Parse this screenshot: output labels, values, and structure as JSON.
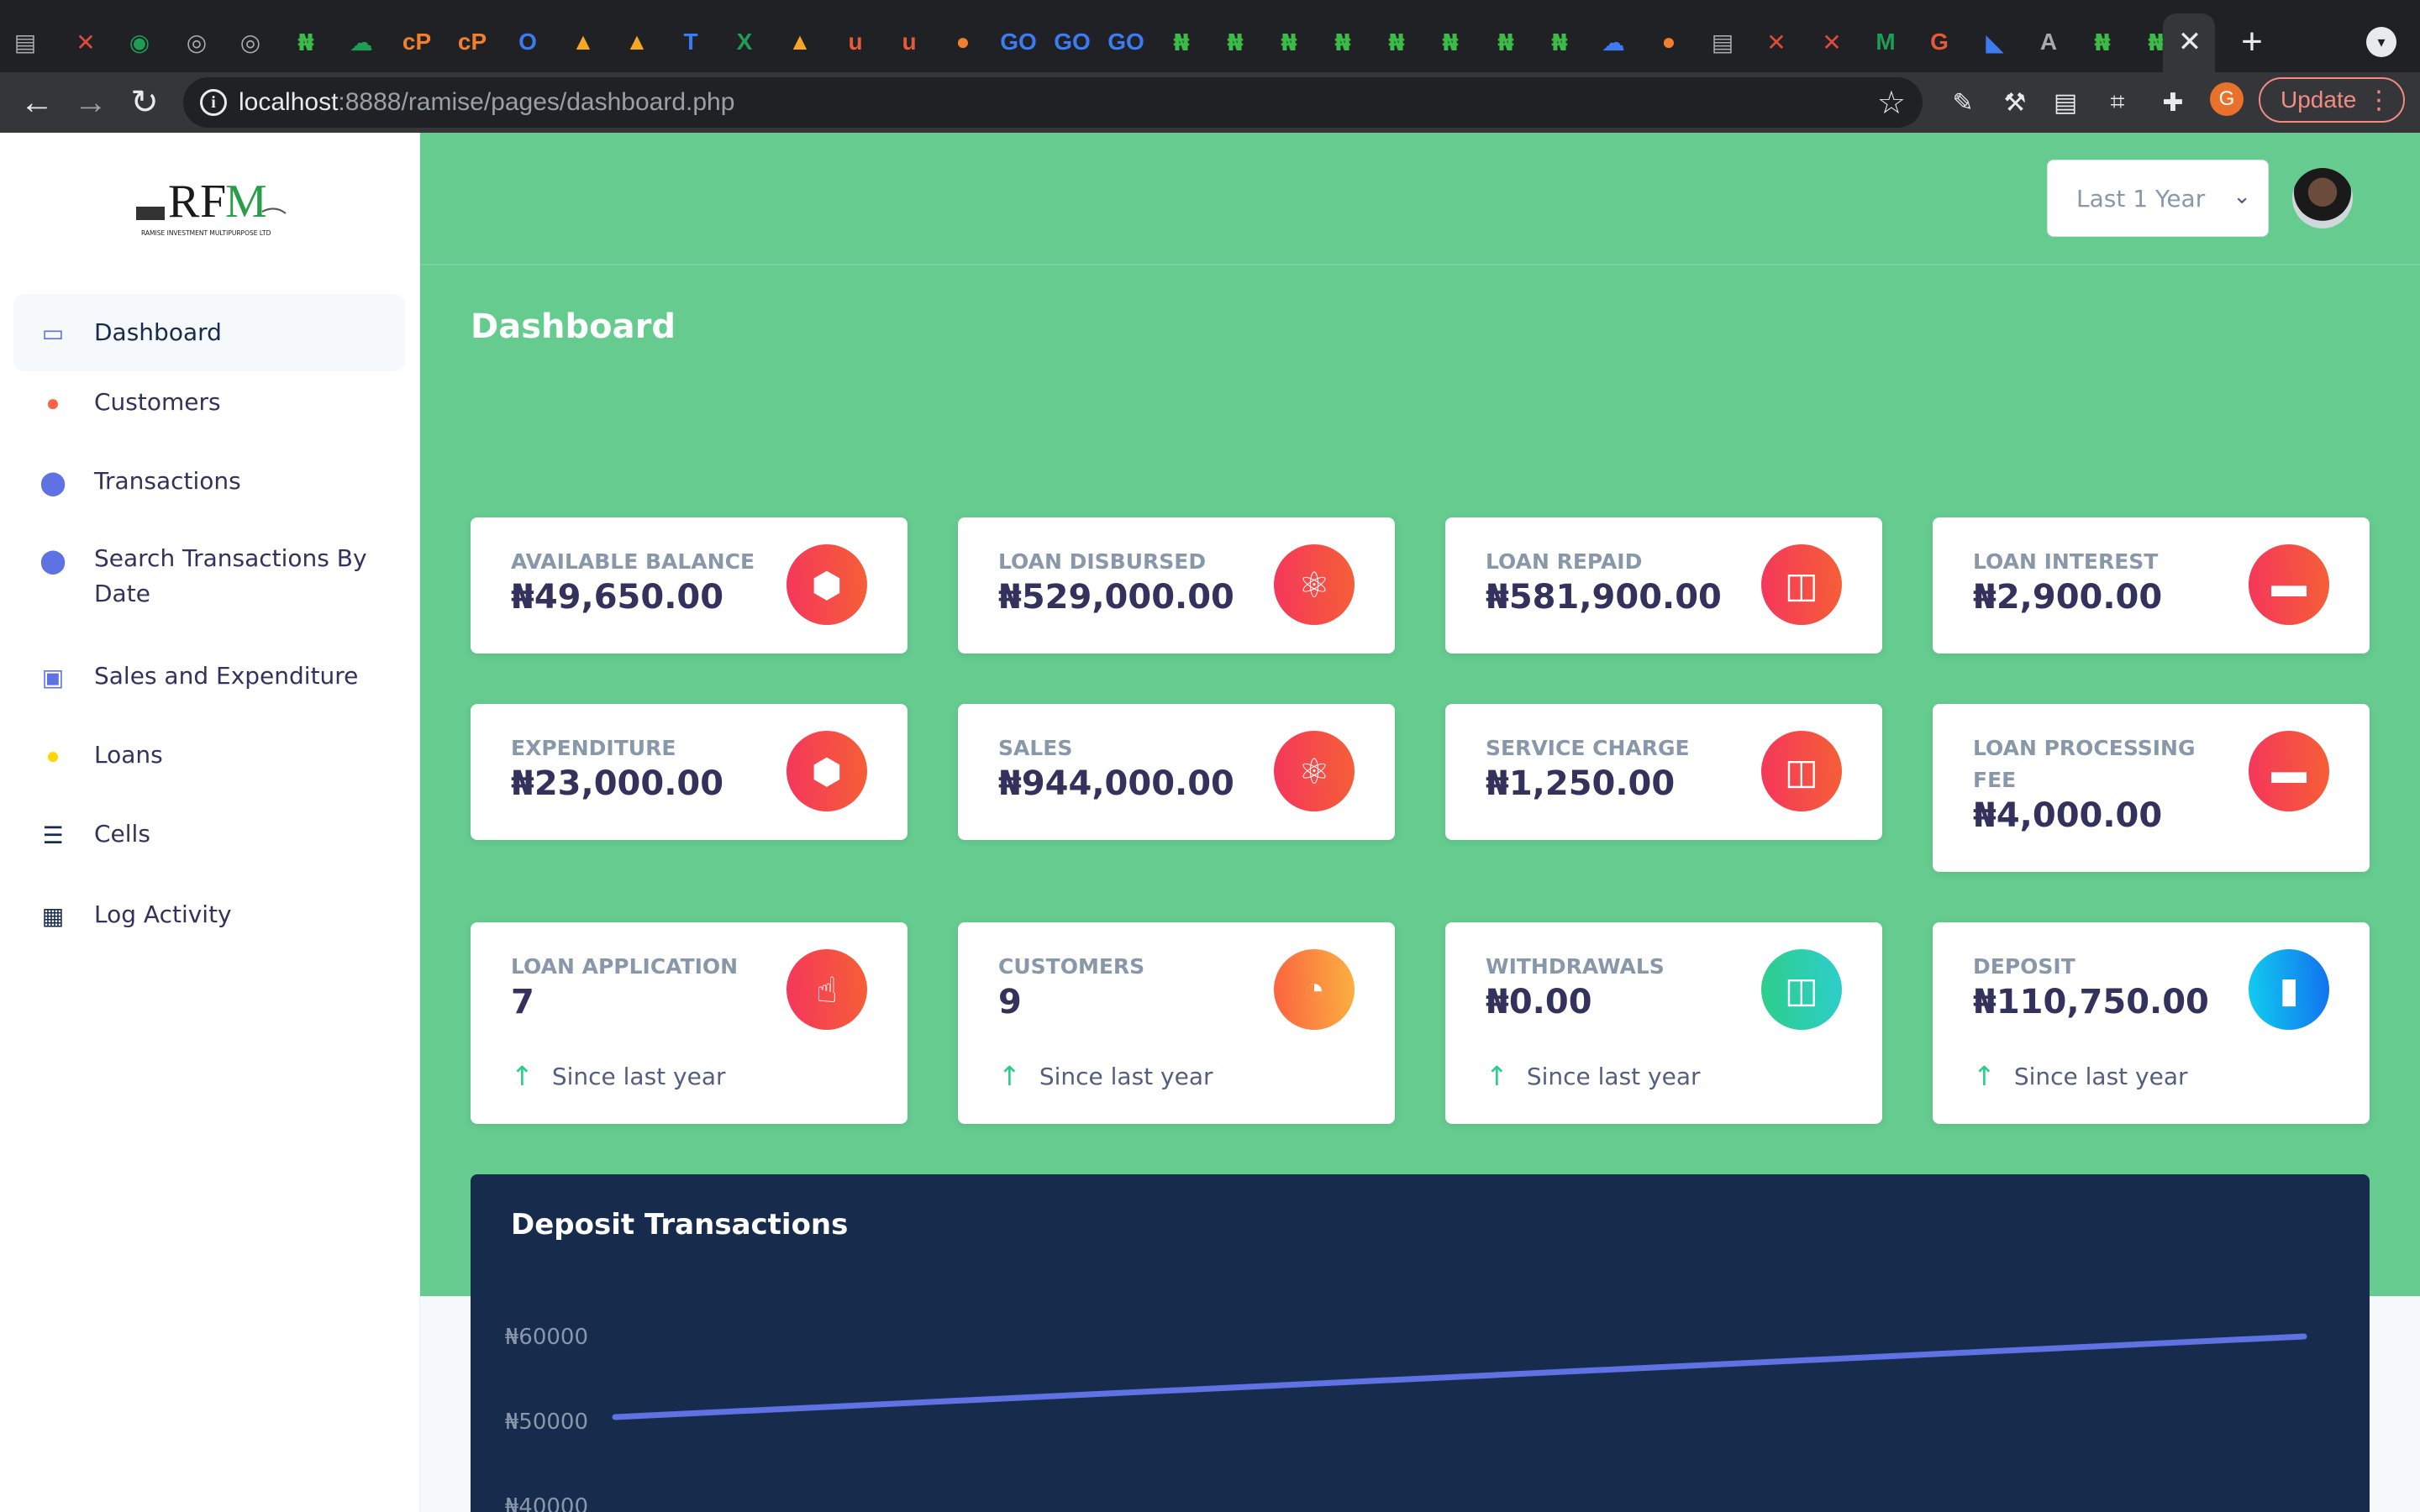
{
  "browser": {
    "url_host": "localhost",
    "url_rest": ":8888/ramise/pages/dashboard.php",
    "close_tab_glyph": "✕",
    "new_tab_glyph": "+",
    "update_label": "Update",
    "profile_initial": "G",
    "tab_favicons": [
      "tab-icon",
      "x-icon",
      "whatsapp-icon",
      "globe-icon",
      "globe-icon",
      "naira-icon",
      "cloud-icon",
      "cpanel-icon",
      "cpanel-icon",
      "outlook-icon",
      "firebase-icon",
      "firebase-icon",
      "teams-icon",
      "excel-icon",
      "firebase-icon",
      "u-icon",
      "u-icon",
      "bean-icon",
      "go-icon",
      "go-icon",
      "go-icon",
      "naira-icon",
      "naira-icon",
      "naira-icon",
      "naira-icon",
      "naira-icon",
      "naira-icon",
      "naira-icon",
      "naira-icon",
      "onedrive-icon",
      "bean-icon",
      "tab-icon",
      "x-icon",
      "x-icon",
      "m-icon",
      "google-icon",
      "flutter-icon",
      "a-icon",
      "naira-icon",
      "naira-icon"
    ]
  },
  "sidebar": {
    "logo_text": "RFM",
    "logo_subtitle": "RAMISE INVESTMENT MULTIPURPOSE LTD",
    "items": [
      {
        "label": "Dashboard",
        "icon": "monitor-icon",
        "color": "#5e72e4"
      },
      {
        "label": "Customers",
        "icon": "planet-icon",
        "color": "#fb6340"
      },
      {
        "label": "Transactions",
        "icon": "pin-icon",
        "color": "#5e72e4"
      },
      {
        "label": "Search Transactions By Date",
        "icon": "pin-icon",
        "color": "#5e72e4"
      },
      {
        "label": "Sales and Expenditure",
        "icon": "shopping-bag-icon",
        "color": "#5e72e4"
      },
      {
        "label": "Loans",
        "icon": "user-icon",
        "color": "#ffd600"
      },
      {
        "label": "Cells",
        "icon": "list-icon",
        "color": "#172b4d"
      },
      {
        "label": "Log Activity",
        "icon": "document-icon",
        "color": "#172b4d"
      }
    ]
  },
  "header": {
    "period": "Last 1 Year",
    "page_title": "Dashboard"
  },
  "stats": [
    {
      "label": "AVAILABLE BALANCE",
      "value": "₦49,650.00",
      "icon": "box-icon",
      "color": "red"
    },
    {
      "label": "LOAN DISBURSED",
      "value": "₦529,000.00",
      "icon": "atom-icon",
      "color": "red"
    },
    {
      "label": "LOAN REPAID",
      "value": "₦581,900.00",
      "icon": "bag-icon",
      "color": "red"
    },
    {
      "label": "LOAN INTEREST",
      "value": "₦2,900.00",
      "icon": "briefcase-icon",
      "color": "red"
    },
    {
      "label": "EXPENDITURE",
      "value": "₦23,000.00",
      "icon": "box-icon",
      "color": "red"
    },
    {
      "label": "SALES",
      "value": "₦944,000.00",
      "icon": "atom-icon",
      "color": "red"
    },
    {
      "label": "SERVICE CHARGE",
      "value": "₦1,250.00",
      "icon": "bag-icon",
      "color": "red"
    },
    {
      "label": "LOAN PROCESSING FEE",
      "value": "₦4,000.00",
      "icon": "briefcase-icon",
      "color": "red"
    },
    {
      "label": "LOAN APPLICATION",
      "value": "7",
      "icon": "pointer-icon",
      "color": "red",
      "footer": "Since last year"
    },
    {
      "label": "CUSTOMERS",
      "value": "9",
      "icon": "pie-chart-icon",
      "color": "orange",
      "footer": "Since last year"
    },
    {
      "label": "WITHDRAWALS",
      "value": "₦0.00",
      "icon": "coins-icon",
      "color": "green",
      "footer": "Since last year"
    },
    {
      "label": "DEPOSIT",
      "value": "₦110,750.00",
      "icon": "bar-chart-icon",
      "color": "blue",
      "footer": "Since last year"
    }
  ],
  "chart_data": {
    "type": "line",
    "title": "Deposit Transactions",
    "y_ticks": [
      "₦60000",
      "₦50000",
      "₦40000"
    ],
    "series": [
      {
        "values": [
          50500,
          60000
        ]
      }
    ],
    "ylim": [
      40000,
      60000
    ],
    "line_color": "#5e72e4",
    "grid": false
  },
  "colors": {
    "header_bg": "#65cb8f",
    "chart_bg": "#172b4d",
    "accent": "#5e72e4"
  }
}
